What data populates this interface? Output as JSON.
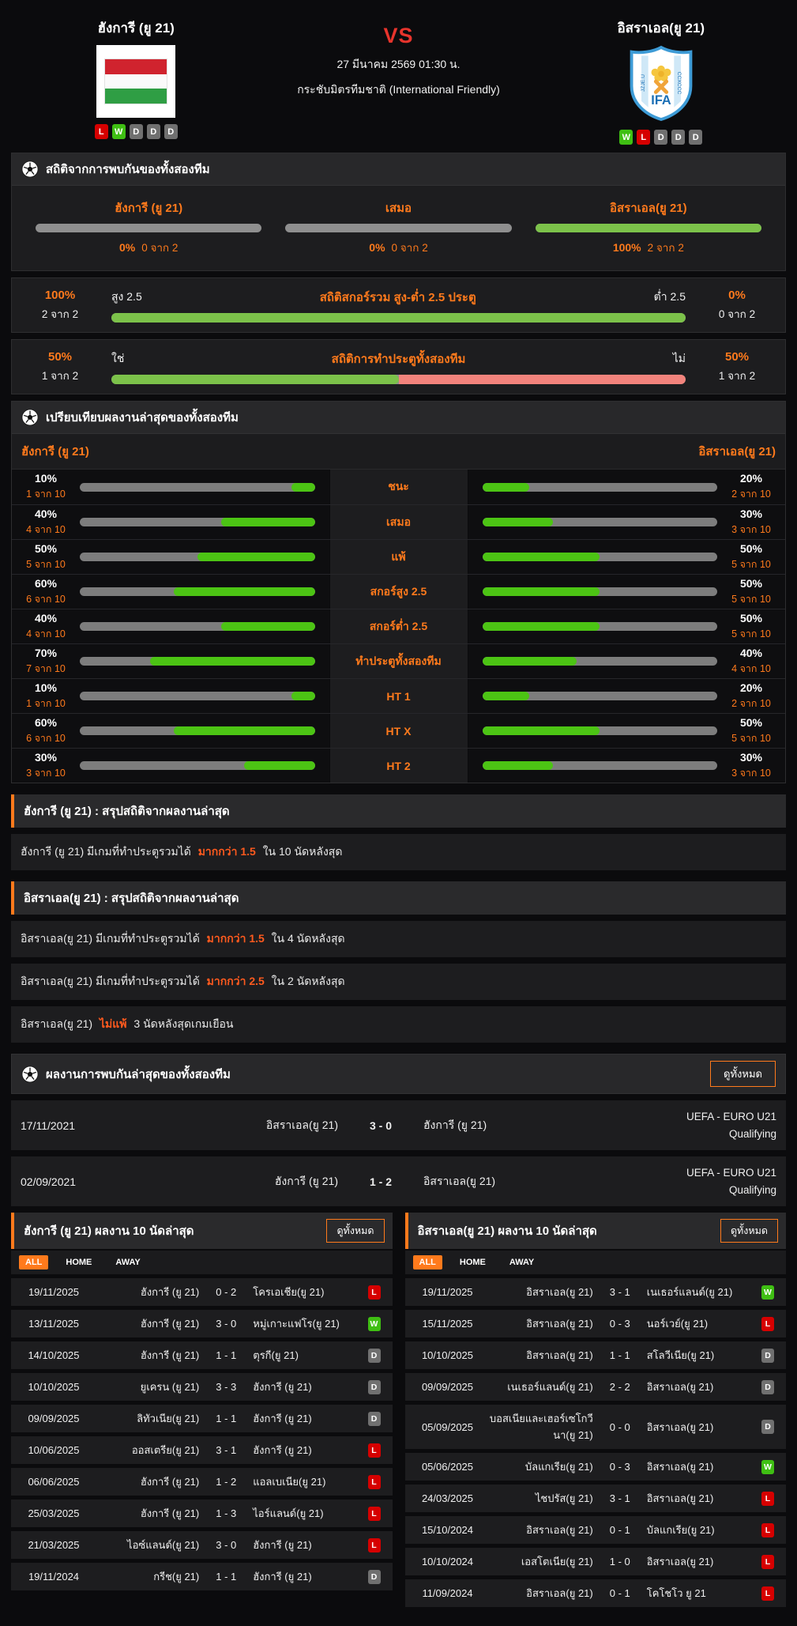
{
  "colors": {
    "accent": "#ff7a1c",
    "accent_red": "#ff5a1e",
    "vs_red": "#e8342c",
    "green_soft": "#7cc24a",
    "green": "#4cc414",
    "pink": "#f2837c",
    "bar_gray": "#8f8f8f",
    "win": "#3fbf13",
    "lose": "#d60000",
    "draw": "#707070"
  },
  "header": {
    "home": {
      "name": "ฮังการี (ยู 21)",
      "form": [
        "L",
        "W",
        "D",
        "D",
        "D"
      ]
    },
    "away": {
      "name": "อิสราเอล(ยู 21)",
      "form": [
        "W",
        "L",
        "D",
        "D",
        "D"
      ],
      "logo_text": "IFA"
    },
    "vs": "VS",
    "datetime": "27 มีนาคม 2569 01:30 น.",
    "competition": "กระชับมิตรทีมชาติ (International Friendly)"
  },
  "h2h_stats": {
    "title": "สถิติจากการพบกันของทั้งสองทีม",
    "columns": [
      {
        "label": "ฮังการี (ยู 21)",
        "pct": "0%",
        "count": "0 จาก 2",
        "fill": 0
      },
      {
        "label": "เสมอ",
        "pct": "0%",
        "count": "0 จาก 2",
        "fill": 0
      },
      {
        "label": "อิสราเอล(ยู 21)",
        "pct": "100%",
        "count": "2 จาก 2",
        "fill": 100
      }
    ],
    "rows": [
      {
        "left_pct": "100%",
        "left_count": "2 จาก 2",
        "label_left": "สูง 2.5",
        "title": "สถิติสกอร์รวม สูง-ต่ำ 2.5 ประตู",
        "label_right": "ต่ำ 2.5",
        "right_pct": "0%",
        "right_count": "0 จาก 2",
        "green": 100,
        "pink": 0
      },
      {
        "left_pct": "50%",
        "left_count": "1 จาก 2",
        "label_left": "ใช่",
        "title": "สถิติการทำประตูทั้งสองทีม",
        "label_right": "ไม่",
        "right_pct": "50%",
        "right_count": "1 จาก 2",
        "green": 50,
        "pink": 50
      }
    ]
  },
  "compare": {
    "title": "เปรียบเทียบผลงานล่าสุดของทั้งสองทีม",
    "home_name": "ฮังการี (ยู 21)",
    "away_name": "อิสราเอล(ยู 21)",
    "rows": [
      {
        "label": "ชนะ",
        "l_pct": "10%",
        "l_count": "1 จาก 10",
        "l_val": 10,
        "r_pct": "20%",
        "r_count": "2 จาก 10",
        "r_val": 20
      },
      {
        "label": "เสมอ",
        "l_pct": "40%",
        "l_count": "4 จาก 10",
        "l_val": 40,
        "r_pct": "30%",
        "r_count": "3 จาก 10",
        "r_val": 30
      },
      {
        "label": "แพ้",
        "l_pct": "50%",
        "l_count": "5 จาก 10",
        "l_val": 50,
        "r_pct": "50%",
        "r_count": "5 จาก 10",
        "r_val": 50
      },
      {
        "label": "สกอร์สูง 2.5",
        "l_pct": "60%",
        "l_count": "6 จาก 10",
        "l_val": 60,
        "r_pct": "50%",
        "r_count": "5 จาก 10",
        "r_val": 50
      },
      {
        "label": "สกอร์ต่ำ 2.5",
        "l_pct": "40%",
        "l_count": "4 จาก 10",
        "l_val": 40,
        "r_pct": "50%",
        "r_count": "5 จาก 10",
        "r_val": 50
      },
      {
        "label": "ทำประตูทั้งสองทีม",
        "l_pct": "70%",
        "l_count": "7 จาก 10",
        "l_val": 70,
        "r_pct": "40%",
        "r_count": "4 จาก 10",
        "r_val": 40
      },
      {
        "label": "HT 1",
        "l_pct": "10%",
        "l_count": "1 จาก 10",
        "l_val": 10,
        "r_pct": "20%",
        "r_count": "2 จาก 10",
        "r_val": 20
      },
      {
        "label": "HT X",
        "l_pct": "60%",
        "l_count": "6 จาก 10",
        "l_val": 60,
        "r_pct": "50%",
        "r_count": "5 จาก 10",
        "r_val": 50
      },
      {
        "label": "HT 2",
        "l_pct": "30%",
        "l_count": "3 จาก 10",
        "l_val": 30,
        "r_pct": "30%",
        "r_count": "3 จาก 10",
        "r_val": 30
      }
    ]
  },
  "summary_home": {
    "title": "ฮังการี (ยู 21) : สรุปสถิติจากผลงานล่าสุด",
    "rows": [
      {
        "pre": "ฮังการี (ยู 21)  มีเกมที่ทำประตูรวมได้",
        "hl": "มากกว่า  1.5",
        "post": "ใน 10 นัดหลังสุด"
      }
    ]
  },
  "summary_away": {
    "title": "อิสราเอล(ยู 21) : สรุปสถิติจากผลงานล่าสุด",
    "rows": [
      {
        "pre": "อิสราเอล(ยู 21)  มีเกมที่ทำประตูรวมได้",
        "hl": "มากกว่า  1.5",
        "post": "ใน 4 นัดหลังสุด"
      },
      {
        "pre": "อิสราเอล(ยู 21)  มีเกมที่ทำประตูรวมได้",
        "hl": "มากกว่า  2.5",
        "post": "ใน 2 นัดหลังสุด"
      },
      {
        "pre": "อิสราเอล(ยู 21)",
        "hl": "ไม่แพ้",
        "post": "3  นัดหลังสุดเกมเยือน"
      }
    ]
  },
  "h2h_matches": {
    "title": "ผลงานการพบกันล่าสุดของทั้งสองทีม",
    "view_all": "ดูทั้งหมด",
    "rows": [
      {
        "date": "17/11/2021",
        "home": "อิสราเอล(ยู 21)",
        "score": "3 - 0",
        "away": "ฮังการี (ยู 21)",
        "comp": "UEFA - EURO U21 Qualifying"
      },
      {
        "date": "02/09/2021",
        "home": "ฮังการี (ยู 21)",
        "score": "1 - 2",
        "away": "อิสราเอล(ยู 21)",
        "comp": "UEFA - EURO U21 Qualifying"
      }
    ]
  },
  "recent_home": {
    "title": "ฮังการี (ยู 21) ผลงาน 10 นัดล่าสุด",
    "view_all": "ดูทั้งหมด",
    "tabs": [
      "ALL",
      "HOME",
      "AWAY"
    ],
    "active_tab": "ALL",
    "rows": [
      {
        "date": "19/11/2025",
        "home": "ฮังการี (ยู 21)",
        "score": "0 - 2",
        "away": "โครเอเชีย(ยู 21)",
        "result": "L"
      },
      {
        "date": "13/11/2025",
        "home": "ฮังการี (ยู 21)",
        "score": "3 - 0",
        "away": "หมู่เกาะแฟโร(ยู 21)",
        "result": "W"
      },
      {
        "date": "14/10/2025",
        "home": "ฮังการี (ยู 21)",
        "score": "1 - 1",
        "away": "ตุรกี(ยู 21)",
        "result": "D"
      },
      {
        "date": "10/10/2025",
        "home": "ยูเครน (ยู 21)",
        "score": "3 - 3",
        "away": "ฮังการี (ยู 21)",
        "result": "D"
      },
      {
        "date": "09/09/2025",
        "home": "ลิทัวเนีย(ยู 21)",
        "score": "1 - 1",
        "away": "ฮังการี (ยู 21)",
        "result": "D"
      },
      {
        "date": "10/06/2025",
        "home": "ออสเตรีย(ยู 21)",
        "score": "3 - 1",
        "away": "ฮังการี (ยู 21)",
        "result": "L"
      },
      {
        "date": "06/06/2025",
        "home": "ฮังการี (ยู 21)",
        "score": "1 - 2",
        "away": "แอลเบเนีย(ยู 21)",
        "result": "L"
      },
      {
        "date": "25/03/2025",
        "home": "ฮังการี (ยู 21)",
        "score": "1 - 3",
        "away": "ไอร์แลนด์(ยู 21)",
        "result": "L"
      },
      {
        "date": "21/03/2025",
        "home": "ไอซ์แลนด์(ยู 21)",
        "score": "3 - 0",
        "away": "ฮังการี (ยู 21)",
        "result": "L"
      },
      {
        "date": "19/11/2024",
        "home": "กรีช(ยู 21)",
        "score": "1 - 1",
        "away": "ฮังการี (ยู 21)",
        "result": "D"
      }
    ]
  },
  "recent_away": {
    "title": "อิสราเอล(ยู 21) ผลงาน 10 นัดล่าสุด",
    "view_all": "ดูทั้งหมด",
    "tabs": [
      "ALL",
      "HOME",
      "AWAY"
    ],
    "active_tab": "ALL",
    "rows": [
      {
        "date": "19/11/2025",
        "home": "อิสราเอล(ยู 21)",
        "score": "3 - 1",
        "away": "เนเธอร์แลนด์(ยู 21)",
        "result": "W"
      },
      {
        "date": "15/11/2025",
        "home": "อิสราเอล(ยู 21)",
        "score": "0 - 3",
        "away": "นอร์เวย์(ยู 21)",
        "result": "L"
      },
      {
        "date": "10/10/2025",
        "home": "อิสราเอล(ยู 21)",
        "score": "1 - 1",
        "away": "สโลวีเนีย(ยู 21)",
        "result": "D"
      },
      {
        "date": "09/09/2025",
        "home": "เนเธอร์แลนด์(ยู 21)",
        "score": "2 - 2",
        "away": "อิสราเอล(ยู 21)",
        "result": "D"
      },
      {
        "date": "05/09/2025",
        "home": "บอสเนียและเฮอร์เซโกวีนา(ยู 21)",
        "score": "0 - 0",
        "away": "อิสราเอล(ยู 21)",
        "result": "D"
      },
      {
        "date": "05/06/2025",
        "home": "บัลแกเรีย(ยู 21)",
        "score": "0 - 3",
        "away": "อิสราเอล(ยู 21)",
        "result": "W"
      },
      {
        "date": "24/03/2025",
        "home": "ไชปรัส(ยู 21)",
        "score": "3 - 1",
        "away": "อิสราเอล(ยู 21)",
        "result": "L"
      },
      {
        "date": "15/10/2024",
        "home": "อิสราเอล(ยู 21)",
        "score": "0 - 1",
        "away": "บัลแกเรีย(ยู 21)",
        "result": "L"
      },
      {
        "date": "10/10/2024",
        "home": "เอสโตเนีย(ยู 21)",
        "score": "1 - 0",
        "away": "อิสราเอล(ยู 21)",
        "result": "L"
      },
      {
        "date": "11/09/2024",
        "home": "อิสราเอล(ยู 21)",
        "score": "0 - 1",
        "away": "โคโชโว ยู 21",
        "result": "L"
      }
    ]
  }
}
